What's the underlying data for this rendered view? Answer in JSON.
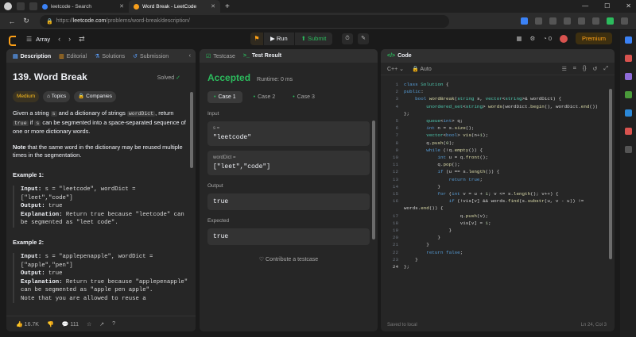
{
  "browser": {
    "tabs": [
      {
        "label": "leetcode - Search",
        "active": false
      },
      {
        "label": "Word Break - LeetCode",
        "active": true
      }
    ],
    "url_prefix": "https://",
    "url_domain": "leetcode.com",
    "url_path": "/problems/word-break/description/"
  },
  "topbar": {
    "list_label": "Array",
    "run_label": "Run",
    "submit_label": "Submit",
    "coins": "0",
    "premium_label": "Premium"
  },
  "left": {
    "tabs": [
      "Description",
      "Editorial",
      "Solutions",
      "Submission"
    ],
    "title": "139. Word Break",
    "solved": "Solved",
    "chips": [
      "Medium",
      "Topics",
      "Companies"
    ],
    "p1_a": "Given a string ",
    "p1_s": "s",
    "p1_b": " and a dictionary of strings ",
    "p1_wd": "wordDict",
    "p1_c": ", return ",
    "p1_true": "true",
    "p1_d": " if ",
    "p1_s2": "s",
    "p1_e": " can be segmented into a space-separated sequence of one or more dictionary words.",
    "note_bold": "Note",
    "note_rest": " that the same word in the dictionary may be reused multiple times in the segmentation.",
    "ex1_title": "Example 1:",
    "ex1_input_label": "Input:",
    "ex1_input": " s = \"leetcode\", wordDict = [\"leet\",\"code\"]",
    "ex1_output_label": "Output:",
    "ex1_output": " true",
    "ex1_expl_label": "Explanation:",
    "ex1_expl": " Return true because \"leetcode\" can be segmented as \"leet code\".",
    "ex2_title": "Example 2:",
    "ex2_input_label": "Input:",
    "ex2_input": " s = \"applepenapple\", wordDict = [\"apple\",\"pen\"]",
    "ex2_output_label": "Output:",
    "ex2_output": " true",
    "ex2_expl_label": "Explanation:",
    "ex2_expl": " Return true because \"applepenapple\" can be segmented as \"apple pen apple\".",
    "ex2_note": "Note that you are allowed to reuse a",
    "likes": "16.7K",
    "comments": "111"
  },
  "middle": {
    "tabs": [
      "Testcase",
      "Test Result"
    ],
    "status": "Accepted",
    "runtime": "Runtime: 0 ms",
    "cases": [
      "Case 1",
      "Case 2",
      "Case 3"
    ],
    "input_label": "Input",
    "s_key": "s =",
    "s_val": "\"leetcode\"",
    "wd_key": "wordDict =",
    "wd_val": "[\"leet\",\"code\"]",
    "output_label": "Output",
    "output_val": "true",
    "expected_label": "Expected",
    "expected_val": "true",
    "contribute": "Contribute a testcase"
  },
  "code": {
    "tab": "Code",
    "language": "C++",
    "auto": "Auto",
    "saved": "Saved to local",
    "position": "Ln 24, Col 3"
  }
}
